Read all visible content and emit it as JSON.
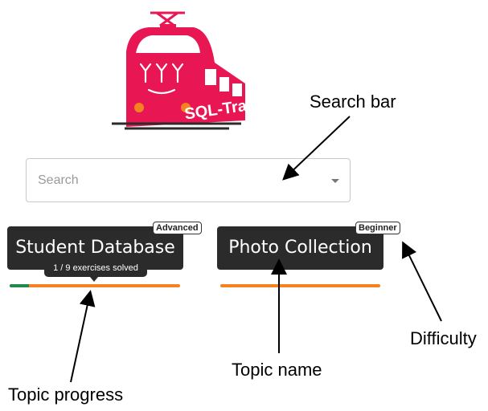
{
  "logo": {
    "text": "SQL-Train",
    "brand_color": "#e81753"
  },
  "search": {
    "placeholder": "Search"
  },
  "topics": [
    {
      "name": "Student Database",
      "difficulty": "Advanced",
      "progress_text": "1 / 9 exercises solved",
      "solved": 1,
      "total": 9,
      "progress_fraction": 0.111
    },
    {
      "name": "Photo Collection",
      "difficulty": "Beginner",
      "progress_fraction": 0
    }
  ],
  "colors": {
    "progress_track": "#f58220",
    "progress_fill": "#1e8a4c",
    "button_bg": "#2b2b2b"
  },
  "annotations": {
    "search_bar": "Search bar",
    "difficulty": "Difficulty",
    "topic_name": "Topic name",
    "topic_progress": "Topic progress"
  }
}
